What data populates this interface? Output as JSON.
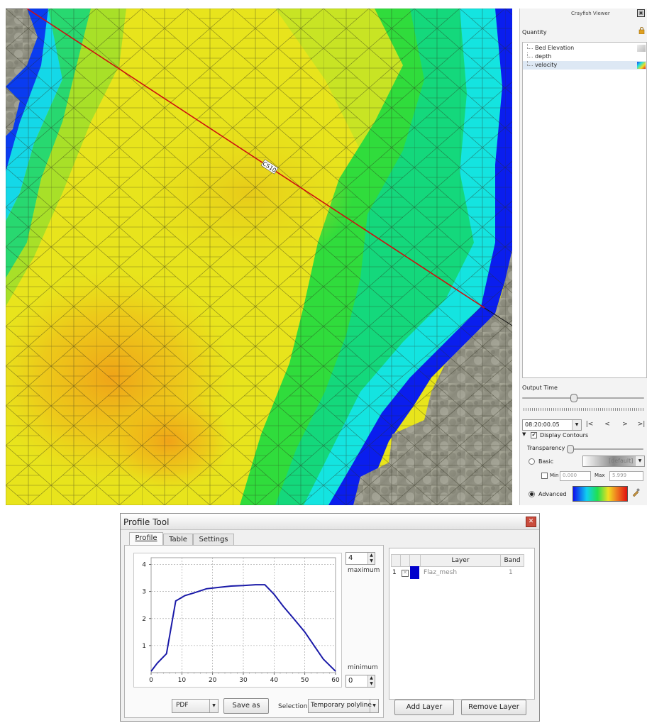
{
  "map": {
    "profile_line_label": "CS10"
  },
  "crayfish": {
    "title": "Crayfish Viewer",
    "quantity_label": "Quantity",
    "quantities": [
      {
        "label": "Bed Elevation",
        "selected": false
      },
      {
        "label": "depth",
        "selected": false
      },
      {
        "label": "velocity",
        "selected": true
      }
    ],
    "output_time_label": "Output Time",
    "time_value": "08:20:00.05",
    "nav": [
      "|<",
      "<",
      ">",
      ">|"
    ],
    "display_contours_label": "Display Contours",
    "display_contours_checked": true,
    "transparency_label": "Transparency",
    "transparency_value": 0.0,
    "time_slider_value": 0.42,
    "basic_label": "Basic",
    "basic_ramp": "[default]",
    "min_label": "Min",
    "min_value": "0.000",
    "max_label": "Max",
    "max_value": "5.999",
    "advanced_label": "Advanced",
    "mode_selected": "advanced"
  },
  "profile_tool": {
    "title": "Profile Tool",
    "tabs": [
      "Profile",
      "Table",
      "Settings"
    ],
    "active_tab": 0,
    "max_spin": "4",
    "max_label": "maximum",
    "min_spin": "0",
    "min_label": "minimum",
    "export_format": "PDF",
    "save_as_label": "Save as",
    "selection_label": "Selection",
    "selection_value": "Temporary polyline",
    "layers_header": {
      "layer": "Layer",
      "band": "Band"
    },
    "layers": [
      {
        "index": "1",
        "name": "Flaz_mesh",
        "band": "1",
        "color": "#0000cc"
      }
    ],
    "add_layer_label": "Add Layer",
    "remove_layer_label": "Remove Layer"
  },
  "chart_data": {
    "type": "line",
    "title": "",
    "xlabel": "",
    "ylabel": "",
    "xlim": [
      0,
      60
    ],
    "ylim": [
      0,
      4.25
    ],
    "xticks": [
      0,
      10,
      20,
      30,
      40,
      50,
      60
    ],
    "yticks": [
      1,
      2,
      3,
      4
    ],
    "grid": true,
    "series": [
      {
        "color": "#1a1aa8",
        "x": [
          0,
          2,
          5,
          8,
          11,
          14,
          18,
          22,
          26,
          30,
          34,
          37,
          40,
          43,
          46,
          50,
          53,
          56,
          60
        ],
        "y": [
          0.05,
          0.35,
          0.7,
          2.65,
          2.85,
          2.95,
          3.1,
          3.15,
          3.2,
          3.22,
          3.25,
          3.25,
          2.9,
          2.45,
          2.05,
          1.5,
          1.0,
          0.5,
          0.05
        ]
      }
    ]
  }
}
